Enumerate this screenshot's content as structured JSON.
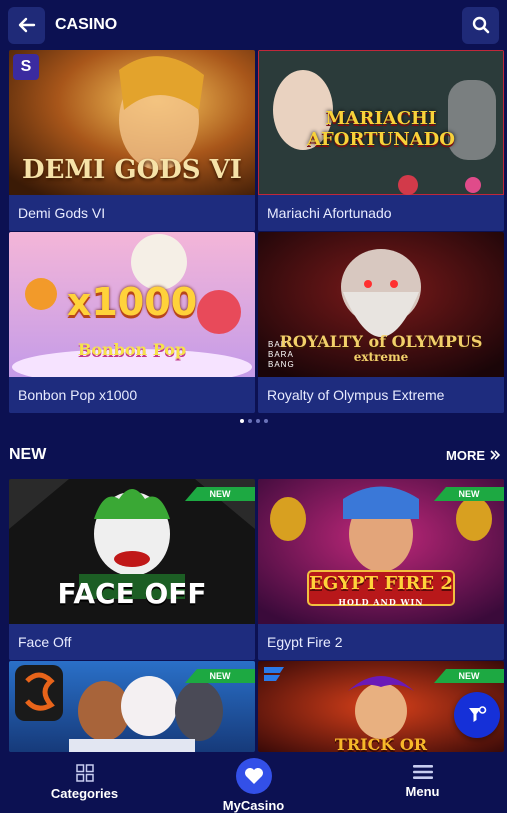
{
  "header": {
    "title": "CASINO"
  },
  "top_games": [
    {
      "caption": "Demi Gods VI",
      "art_text": "DEMI GODS VI"
    },
    {
      "caption": "Mariachi Afortunado",
      "art_text": "MARIACHI AFORTUNADO"
    },
    {
      "caption": "Bonbon Pop x1000",
      "art_text": "x1000",
      "art_sub": "Bonbon Pop"
    },
    {
      "caption": "Royalty of Olympus Extreme",
      "art_text": "ROYALTY of OLYMPUS",
      "art_sub": "extreme",
      "provider": "BAR BARA BANG"
    }
  ],
  "carousel": {
    "pages": 4,
    "active": 1
  },
  "new_section": {
    "title": "NEW",
    "more_label": "MORE",
    "badge_label": "NEW"
  },
  "new_games": [
    {
      "caption": "Face Off",
      "art_text": "FACE OFF"
    },
    {
      "caption": "Egypt Fire 2",
      "art_text": "EGYPT FIRE 2",
      "art_sub": "HOLD AND WIN"
    },
    {
      "caption": "",
      "art_text": ""
    },
    {
      "caption": "",
      "art_text": "TRICK OR"
    }
  ],
  "bottom_nav": {
    "categories": "Categories",
    "mycasino": "MyCasino",
    "menu": "Menu"
  },
  "colors": {
    "background": "#0c1152",
    "caption": "#1e2c7e",
    "accent": "#1530d8",
    "new_badge": "#1da942"
  }
}
